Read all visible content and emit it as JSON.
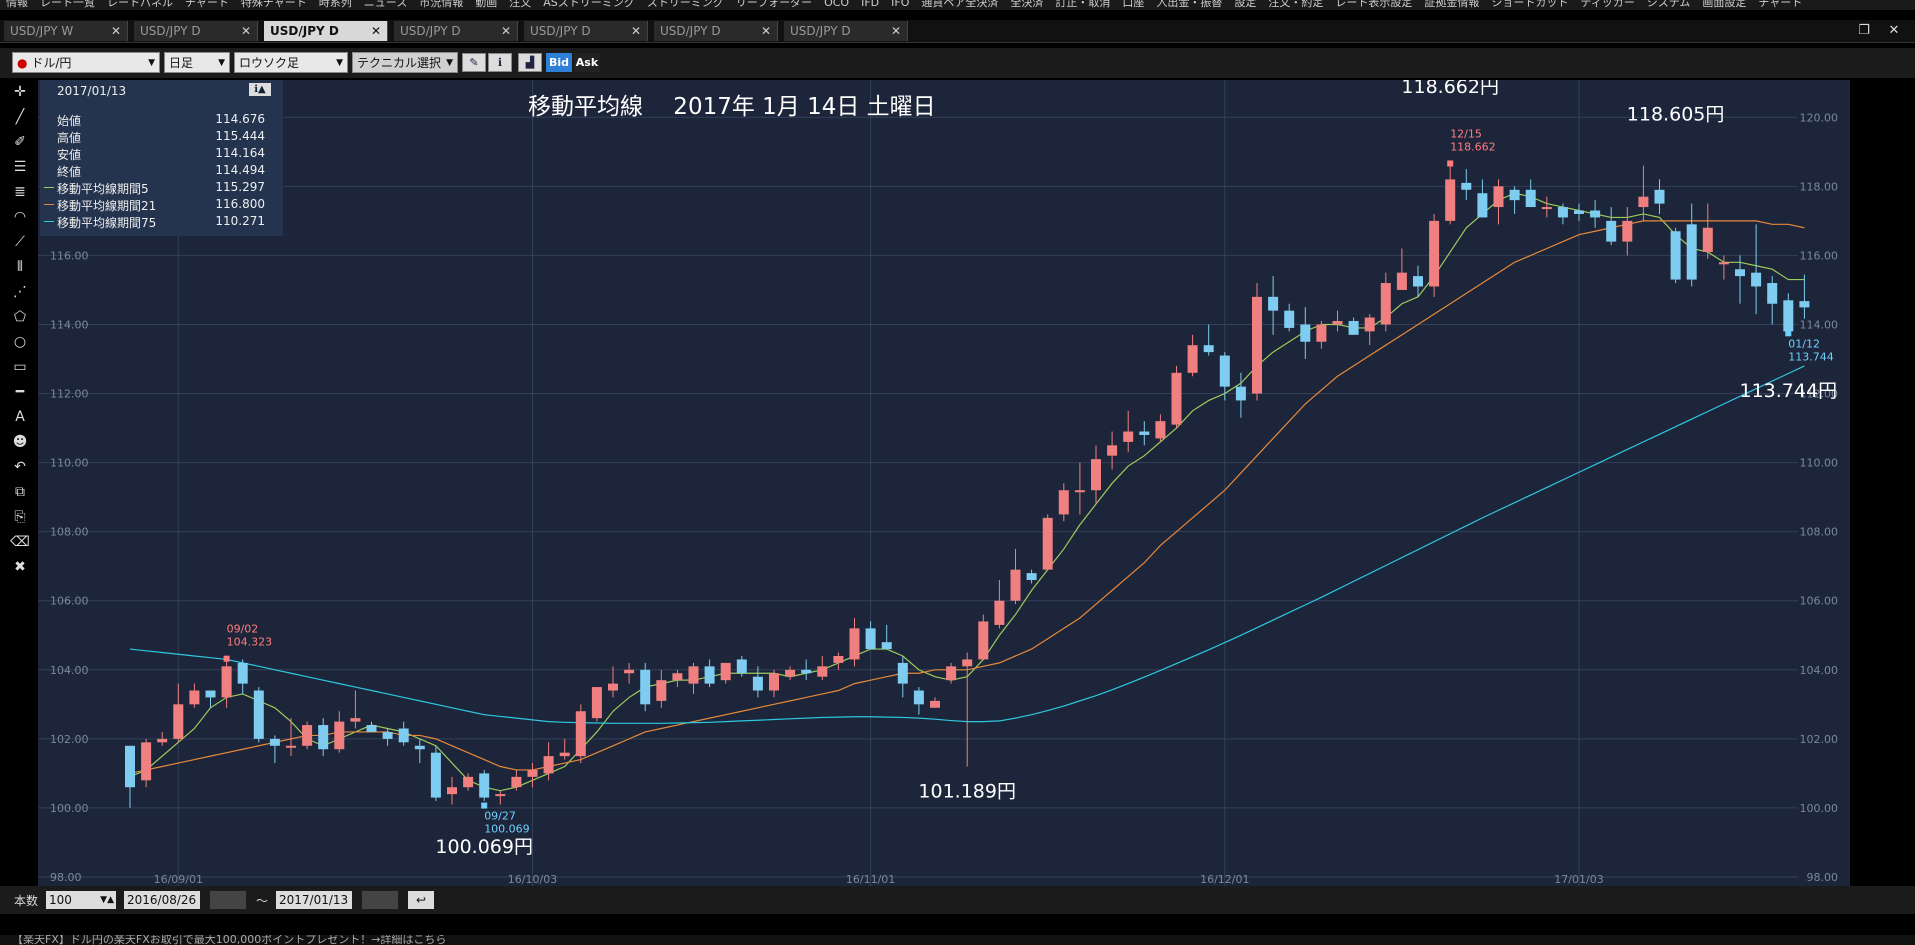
{
  "menu": [
    "情報",
    "レート一覧",
    "レートパネル",
    "チャート",
    "特殊チャート",
    "時系列",
    "ニュース",
    "市況情報",
    "動画",
    "注文",
    "ASストリーミング",
    "ストリーミング",
    "リーフォーダー",
    "OCO",
    "IFD",
    "IFO",
    "通貨ペア全決済",
    "全決済",
    "訂正・取消",
    "口座",
    "入出金・振替",
    "設定",
    "注文・約定",
    "レート表示設定",
    "証拠金情報",
    "ショートカット",
    "ティッカー",
    "システム",
    "画面設定",
    "チャート"
  ],
  "tabs": [
    {
      "label": "USD/JPY W",
      "active": false
    },
    {
      "label": "USD/JPY D",
      "active": false
    },
    {
      "label": "USD/JPY D",
      "active": true
    },
    {
      "label": "USD/JPY D",
      "active": false
    },
    {
      "label": "USD/JPY D",
      "active": false
    },
    {
      "label": "USD/JPY D",
      "active": false
    },
    {
      "label": "USD/JPY D",
      "active": false
    }
  ],
  "toolbar": {
    "pair": "ドル/円",
    "period": "日足",
    "chart_type": "ロウソク足",
    "technical": "テクニカル選択",
    "bid_label": "Bid",
    "ask_label": "Ask"
  },
  "info": {
    "date": "2017/01/13",
    "rows": [
      {
        "label": "始値",
        "value": "114.676",
        "color": "#ffffff"
      },
      {
        "label": "高値",
        "value": "115.444",
        "color": "#ffffff"
      },
      {
        "label": "安値",
        "value": "114.164",
        "color": "#ffffff"
      },
      {
        "label": "終値",
        "value": "114.494",
        "color": "#ffffff"
      },
      {
        "label": "移動平均線期間5",
        "value": "115.297",
        "color": "#9ccc5a"
      },
      {
        "label": "移動平均線期間21",
        "value": "116.800",
        "color": "#e8893a"
      },
      {
        "label": "移動平均線期間75",
        "value": "110.271",
        "color": "#2ec8e0"
      }
    ]
  },
  "bottom": {
    "count_label": "本数",
    "count_value": "100",
    "from_date": "2016/08/26",
    "tilde": "〜",
    "to_date": "2017/01/13"
  },
  "status_text": "【楽天FX】ドル円の楽天FXお取引で最大100,000ポイントプレゼント！→詳細はこちら",
  "chart_data": {
    "type": "candlestick",
    "title": "移動平均線　 2017年 1月 14日 土曜日",
    "ylim": [
      98,
      120.5
    ],
    "yticks": [
      98,
      100,
      102,
      104,
      106,
      108,
      110,
      112,
      114,
      116,
      118,
      120
    ],
    "ytick_labels": [
      "98.00",
      "100.00",
      "102.00",
      "104.00",
      "106.00",
      "108.00",
      "110.00",
      "112.00",
      "114.00",
      "116.00",
      "118.00",
      "120.00"
    ],
    "x_tick_labels": [
      {
        "label": "16/09/01",
        "index": 3
      },
      {
        "label": "16/10/03",
        "index": 25
      },
      {
        "label": "16/11/01",
        "index": 46
      },
      {
        "label": "16/12/01",
        "index": 68
      },
      {
        "label": "17/01/03",
        "index": 90
      }
    ],
    "candles": [
      [
        101.8,
        100.0,
        101.8,
        100.6
      ],
      [
        100.8,
        102.0,
        100.6,
        101.9
      ],
      [
        101.9,
        102.2,
        101.8,
        102.0
      ],
      [
        102.0,
        103.6,
        101.9,
        103.0
      ],
      [
        103.0,
        103.6,
        102.9,
        103.4
      ],
      [
        103.4,
        103.4,
        102.9,
        103.2
      ],
      [
        103.2,
        104.3,
        102.9,
        104.1
      ],
      [
        104.2,
        104.3,
        103.3,
        103.6
      ],
      [
        103.4,
        103.5,
        101.9,
        102.0
      ],
      [
        102.0,
        102.1,
        101.3,
        101.8
      ],
      [
        101.8,
        102.6,
        101.5,
        101.8
      ],
      [
        101.8,
        102.5,
        101.7,
        102.4
      ],
      [
        102.4,
        102.6,
        101.5,
        101.7
      ],
      [
        101.7,
        102.8,
        101.6,
        102.5
      ],
      [
        102.5,
        103.4,
        102.3,
        102.6
      ],
      [
        102.4,
        102.5,
        102.2,
        102.2
      ],
      [
        102.2,
        102.3,
        101.8,
        102.0
      ],
      [
        102.3,
        102.5,
        101.8,
        101.9
      ],
      [
        101.8,
        102.0,
        101.3,
        101.7
      ],
      [
        101.6,
        101.8,
        100.2,
        100.3
      ],
      [
        100.4,
        100.9,
        100.1,
        100.6
      ],
      [
        100.6,
        101.0,
        100.5,
        100.9
      ],
      [
        101.0,
        101.1,
        100.2,
        100.3
      ],
      [
        100.4,
        100.5,
        100.1,
        100.4
      ],
      [
        100.6,
        101.1,
        100.5,
        100.9
      ],
      [
        100.9,
        101.3,
        100.6,
        101.1
      ],
      [
        101.0,
        101.9,
        100.8,
        101.5
      ],
      [
        101.5,
        102.0,
        101.4,
        101.6
      ],
      [
        101.5,
        103.0,
        101.3,
        102.8
      ],
      [
        102.6,
        103.5,
        102.5,
        103.5
      ],
      [
        103.4,
        104.1,
        103.2,
        103.6
      ],
      [
        103.9,
        104.2,
        103.6,
        104.0
      ],
      [
        104.0,
        104.2,
        102.8,
        103.0
      ],
      [
        103.1,
        104.0,
        102.9,
        103.7
      ],
      [
        103.7,
        104.0,
        103.5,
        103.9
      ],
      [
        103.6,
        104.2,
        103.3,
        104.1
      ],
      [
        104.1,
        104.3,
        103.5,
        103.6
      ],
      [
        103.7,
        104.2,
        103.6,
        104.2
      ],
      [
        104.3,
        104.4,
        103.8,
        103.9
      ],
      [
        103.8,
        104.1,
        103.2,
        103.4
      ],
      [
        103.4,
        104.0,
        103.2,
        103.9
      ],
      [
        103.8,
        104.1,
        103.7,
        104.0
      ],
      [
        104.0,
        104.3,
        103.7,
        103.9
      ],
      [
        103.8,
        104.4,
        103.7,
        104.1
      ],
      [
        104.2,
        104.5,
        104.0,
        104.4
      ],
      [
        104.3,
        105.5,
        104.1,
        105.2
      ],
      [
        105.2,
        105.4,
        104.6,
        104.6
      ],
      [
        104.8,
        105.3,
        104.6,
        104.6
      ],
      [
        104.2,
        104.4,
        103.2,
        103.6
      ],
      [
        103.4,
        103.5,
        102.7,
        103.0
      ],
      [
        102.9,
        103.2,
        102.9,
        103.1
      ],
      [
        103.7,
        104.2,
        103.6,
        104.1
      ],
      [
        104.1,
        104.5,
        101.2,
        104.3
      ],
      [
        104.3,
        105.6,
        104.3,
        105.4
      ],
      [
        105.3,
        106.6,
        105.2,
        106.0
      ],
      [
        106.0,
        107.5,
        105.9,
        106.9
      ],
      [
        106.8,
        106.9,
        106.5,
        106.6
      ],
      [
        106.9,
        108.5,
        106.9,
        108.4
      ],
      [
        108.5,
        109.4,
        108.3,
        109.2
      ],
      [
        109.2,
        110.0,
        108.5,
        109.2
      ],
      [
        109.2,
        110.5,
        108.8,
        110.1
      ],
      [
        110.2,
        110.9,
        109.8,
        110.5
      ],
      [
        110.6,
        111.5,
        110.3,
        110.9
      ],
      [
        110.9,
        111.2,
        110.5,
        110.8
      ],
      [
        110.7,
        111.4,
        110.6,
        111.2
      ],
      [
        111.1,
        112.8,
        111.0,
        112.6
      ],
      [
        112.6,
        113.7,
        112.5,
        113.4
      ],
      [
        113.4,
        114.0,
        113.1,
        113.2
      ],
      [
        113.1,
        113.2,
        111.8,
        112.2
      ],
      [
        112.2,
        112.6,
        111.3,
        111.8
      ],
      [
        112.0,
        115.2,
        111.8,
        114.8
      ],
      [
        114.8,
        115.4,
        113.7,
        114.4
      ],
      [
        114.4,
        114.6,
        113.8,
        113.9
      ],
      [
        114.0,
        114.5,
        113.0,
        113.5
      ],
      [
        113.5,
        114.1,
        113.3,
        114.0
      ],
      [
        114.0,
        114.4,
        113.8,
        114.1
      ],
      [
        114.1,
        114.2,
        113.7,
        113.7
      ],
      [
        113.8,
        114.3,
        113.4,
        114.2
      ],
      [
        114.0,
        115.5,
        113.8,
        115.2
      ],
      [
        115.0,
        116.2,
        115.0,
        115.5
      ],
      [
        115.4,
        115.7,
        114.8,
        115.1
      ],
      [
        115.1,
        117.2,
        114.8,
        117.0
      ],
      [
        117.0,
        118.7,
        116.9,
        118.2
      ],
      [
        118.1,
        118.5,
        117.6,
        117.9
      ],
      [
        117.8,
        118.2,
        117.1,
        117.1
      ],
      [
        117.4,
        118.2,
        116.9,
        118.0
      ],
      [
        117.9,
        118.0,
        117.2,
        117.6
      ],
      [
        117.9,
        118.2,
        117.4,
        117.4
      ],
      [
        117.4,
        117.7,
        117.1,
        117.4
      ],
      [
        117.4,
        117.5,
        116.9,
        117.1
      ],
      [
        117.3,
        117.5,
        117.0,
        117.2
      ],
      [
        117.3,
        117.6,
        116.8,
        117.1
      ],
      [
        117.0,
        117.4,
        116.3,
        116.4
      ],
      [
        116.4,
        117.4,
        116.0,
        117.0
      ],
      [
        117.4,
        118.6,
        117.0,
        117.7
      ],
      [
        117.9,
        118.2,
        117.2,
        117.5
      ],
      [
        116.7,
        116.8,
        115.2,
        115.3
      ],
      [
        116.9,
        117.5,
        115.1,
        115.3
      ],
      [
        116.1,
        117.5,
        115.9,
        116.8
      ],
      [
        115.8,
        116.0,
        115.3,
        115.8
      ],
      [
        115.6,
        116.0,
        114.6,
        115.4
      ],
      [
        115.5,
        116.9,
        114.3,
        115.1
      ],
      [
        115.2,
        115.4,
        114.0,
        114.6
      ],
      [
        114.7,
        114.9,
        113.7,
        113.8
      ],
      [
        114.676,
        115.444,
        114.164,
        114.494
      ]
    ],
    "ma": [
      {
        "name": "移動平均線期間5",
        "color": "#9ccc5a",
        "values": [
          100.9,
          101.1,
          101.5,
          101.9,
          102.3,
          102.9,
          103.2,
          103.3,
          103.1,
          102.9,
          102.5,
          102.0,
          101.8,
          102.0,
          102.2,
          102.4,
          102.3,
          102.2,
          102.0,
          101.8,
          101.3,
          100.8,
          100.6,
          100.5,
          100.6,
          100.8,
          101.0,
          101.2,
          101.7,
          102.2,
          102.8,
          103.2,
          103.5,
          103.6,
          103.7,
          103.7,
          103.8,
          103.9,
          103.9,
          103.9,
          103.9,
          103.8,
          103.9,
          104.0,
          104.2,
          104.4,
          104.6,
          104.6,
          104.4,
          104.0,
          103.8,
          103.7,
          103.8,
          104.3,
          105.0,
          105.6,
          106.3,
          106.9,
          107.5,
          108.2,
          108.8,
          109.4,
          109.9,
          110.2,
          110.6,
          111.0,
          111.5,
          111.8,
          112.0,
          112.3,
          112.8,
          113.2,
          113.5,
          113.8,
          114.0,
          114.0,
          113.9,
          113.9,
          114.2,
          114.6,
          114.8,
          115.4,
          116.1,
          116.8,
          117.2,
          117.6,
          117.8,
          117.7,
          117.5,
          117.4,
          117.3,
          117.2,
          117.1,
          117.1,
          117.2,
          117.1,
          116.6,
          116.2,
          116.1,
          115.8,
          115.8,
          115.7,
          115.6,
          115.3,
          115.3
        ]
      },
      {
        "name": "移動平均線期間21",
        "color": "#e8893a",
        "values": [
          101.0,
          101.1,
          101.2,
          101.3,
          101.4,
          101.5,
          101.6,
          101.7,
          101.8,
          101.9,
          102.0,
          102.1,
          102.1,
          102.2,
          102.2,
          102.2,
          102.2,
          102.1,
          102.1,
          102.0,
          101.8,
          101.6,
          101.4,
          101.2,
          101.1,
          101.1,
          101.2,
          101.3,
          101.4,
          101.6,
          101.8,
          102.0,
          102.2,
          102.3,
          102.4,
          102.5,
          102.6,
          102.7,
          102.8,
          102.9,
          103.0,
          103.1,
          103.2,
          103.3,
          103.4,
          103.6,
          103.7,
          103.8,
          103.9,
          103.9,
          104.0,
          104.0,
          104.0,
          104.1,
          104.2,
          104.4,
          104.6,
          104.9,
          105.2,
          105.5,
          105.9,
          106.3,
          106.7,
          107.1,
          107.6,
          108.0,
          108.4,
          108.8,
          109.2,
          109.7,
          110.2,
          110.7,
          111.2,
          111.7,
          112.1,
          112.5,
          112.8,
          113.1,
          113.4,
          113.7,
          114.0,
          114.3,
          114.6,
          114.9,
          115.2,
          115.5,
          115.8,
          116.0,
          116.2,
          116.4,
          116.6,
          116.7,
          116.8,
          116.9,
          117.0,
          117.0,
          117.0,
          117.0,
          117.0,
          117.0,
          117.0,
          117.0,
          116.9,
          116.9,
          116.8
        ]
      },
      {
        "name": "移動平均線期間75",
        "color": "#2ec8e0",
        "values": [
          104.6,
          104.55,
          104.5,
          104.45,
          104.4,
          104.35,
          104.3,
          104.2,
          104.1,
          104.0,
          103.9,
          103.8,
          103.7,
          103.6,
          103.5,
          103.4,
          103.3,
          103.2,
          103.1,
          103.0,
          102.9,
          102.8,
          102.7,
          102.65,
          102.6,
          102.55,
          102.5,
          102.48,
          102.47,
          102.46,
          102.45,
          102.45,
          102.45,
          102.45,
          102.46,
          102.47,
          102.48,
          102.5,
          102.52,
          102.54,
          102.56,
          102.58,
          102.6,
          102.62,
          102.63,
          102.64,
          102.64,
          102.63,
          102.62,
          102.6,
          102.57,
          102.53,
          102.5,
          102.5,
          102.52,
          102.6,
          102.7,
          102.82,
          102.95,
          103.1,
          103.25,
          103.42,
          103.6,
          103.79,
          103.98,
          104.18,
          104.38,
          104.58,
          104.79,
          105.0,
          105.22,
          105.44,
          105.66,
          105.88,
          106.1,
          106.33,
          106.56,
          106.79,
          107.02,
          107.25,
          107.48,
          107.71,
          107.94,
          108.17,
          108.4,
          108.62,
          108.84,
          109.06,
          109.28,
          109.5,
          109.72,
          109.94,
          110.16,
          110.38,
          110.6,
          110.82,
          111.04,
          111.26,
          111.48,
          111.7,
          111.92,
          112.14,
          112.36,
          112.58,
          112.8
        ]
      }
    ],
    "annotations": [
      {
        "text": "09/02",
        "sub": "104.323",
        "index": 6,
        "value": 104.323,
        "color": "#ff7d7d",
        "pos": "above"
      },
      {
        "text": "09/27",
        "sub": "100.069",
        "index": 22,
        "value": 100.069,
        "color": "#6fd0ff",
        "pos": "below"
      },
      {
        "text": "12/15",
        "sub": "118.662",
        "index": 82,
        "value": 118.662,
        "color": "#ff7d7d",
        "pos": "above"
      },
      {
        "text": "01/12",
        "sub": "113.744",
        "index": 103,
        "value": 113.744,
        "color": "#6fd0ff",
        "pos": "below"
      }
    ],
    "callouts": [
      {
        "text": "118.662円",
        "index": 82,
        "value": 120.7
      },
      {
        "text": "118.605円",
        "index": 96,
        "value": 119.9
      },
      {
        "text": "113.744円",
        "index": 103,
        "value": 111.9
      },
      {
        "text": "101.189円",
        "index": 52,
        "value": 100.3
      },
      {
        "text": "100.069円",
        "index": 22,
        "value": 98.7
      }
    ]
  }
}
